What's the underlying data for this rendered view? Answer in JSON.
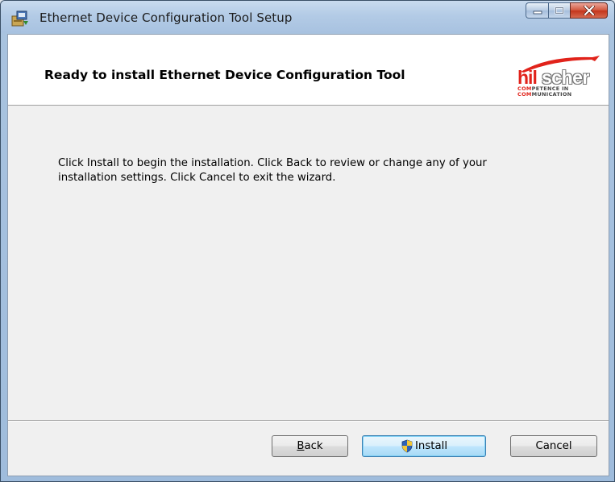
{
  "window": {
    "title": "Ethernet Device Configuration Tool Setup",
    "app_icon": "installer-package-icon",
    "caption_buttons": [
      "minimize-icon",
      "maximize-icon",
      "close-icon"
    ]
  },
  "banner": {
    "title": "Ready to install Ethernet Device Configuration Tool",
    "logo": {
      "name": "hilscher",
      "hil": "hil",
      "scher": "scher",
      "tag_line1_red": "COM",
      "tag_line1_rest": "PETENCE IN",
      "tag_line2_red": "COM",
      "tag_line2_rest": "MUNICATION"
    }
  },
  "body": {
    "message_line1": "Click Install to begin the installation. Click Back to review or change any of your",
    "message_line2": "installation settings. Click Cancel to exit the wizard."
  },
  "buttons": {
    "back_accel": "B",
    "back_rest": "ack",
    "install_label": "Install",
    "install_icon": "uac-shield-icon",
    "cancel_label": "Cancel"
  },
  "colors": {
    "brand_red": "#e1231b",
    "titlebar": "#b3cbe6",
    "default_button": "#bee6fd"
  }
}
